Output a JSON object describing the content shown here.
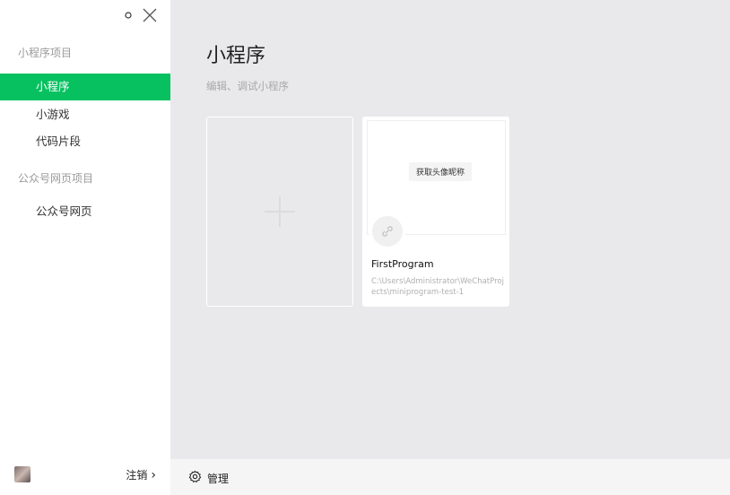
{
  "window_controls": {
    "settings_icon": "settings-dot-icon",
    "close_icon": "close-icon"
  },
  "sidebar": {
    "sections": [
      {
        "title": "小程序项目",
        "items": [
          "小程序",
          "小游戏",
          "代码片段"
        ]
      },
      {
        "title": "公众号网页项目",
        "items": [
          "公众号网页"
        ]
      }
    ],
    "active_item": "小程序",
    "logout_label": "注销",
    "logout_arrow": "›"
  },
  "main": {
    "title": "小程序",
    "subtitle": "编辑、调试小程序",
    "add_card_icon": "plus-icon",
    "project": {
      "preview_button": "获取头像昵称",
      "name": "FirstProgram",
      "path": "C:\\Users\\Administrator\\WeChatProjects\\miniprogram-test-1"
    }
  },
  "footer": {
    "manage_label": "管理",
    "manage_icon": "gear-icon"
  },
  "colors": {
    "accent": "#07c160",
    "main_bg": "#e9e9ec",
    "sidebar_bg": "#ffffff"
  }
}
